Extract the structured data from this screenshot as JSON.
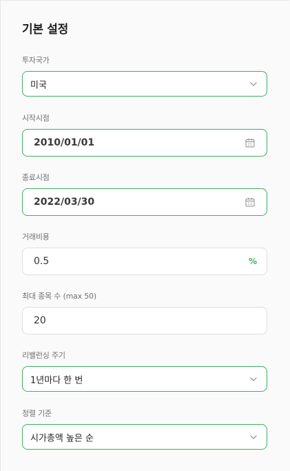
{
  "section": {
    "title": "기본 설정"
  },
  "fields": {
    "country": {
      "label": "투자국가",
      "value": "미국",
      "icon": "chevron-down-icon"
    },
    "start_date": {
      "label": "시작시점",
      "value": "2010/01/01",
      "icon": "calendar-icon"
    },
    "end_date": {
      "label": "종료시점",
      "value": "2022/03/30",
      "icon": "calendar-icon"
    },
    "fee": {
      "label": "거래비용",
      "value": "0.5",
      "suffix": "%"
    },
    "max_stocks": {
      "label": "최대 종목 수 (max 50)",
      "value": "20"
    },
    "rebalance": {
      "label": "리밸런싱 주기",
      "value": "1년마다 한 번",
      "icon": "chevron-down-icon"
    },
    "sort": {
      "label": "정렬 기준",
      "value": "시가총액 높은 순",
      "icon": "chevron-down-icon"
    }
  },
  "colors": {
    "accent": "#3fae62",
    "border_default": "#dedede",
    "background": "#fafafa"
  }
}
